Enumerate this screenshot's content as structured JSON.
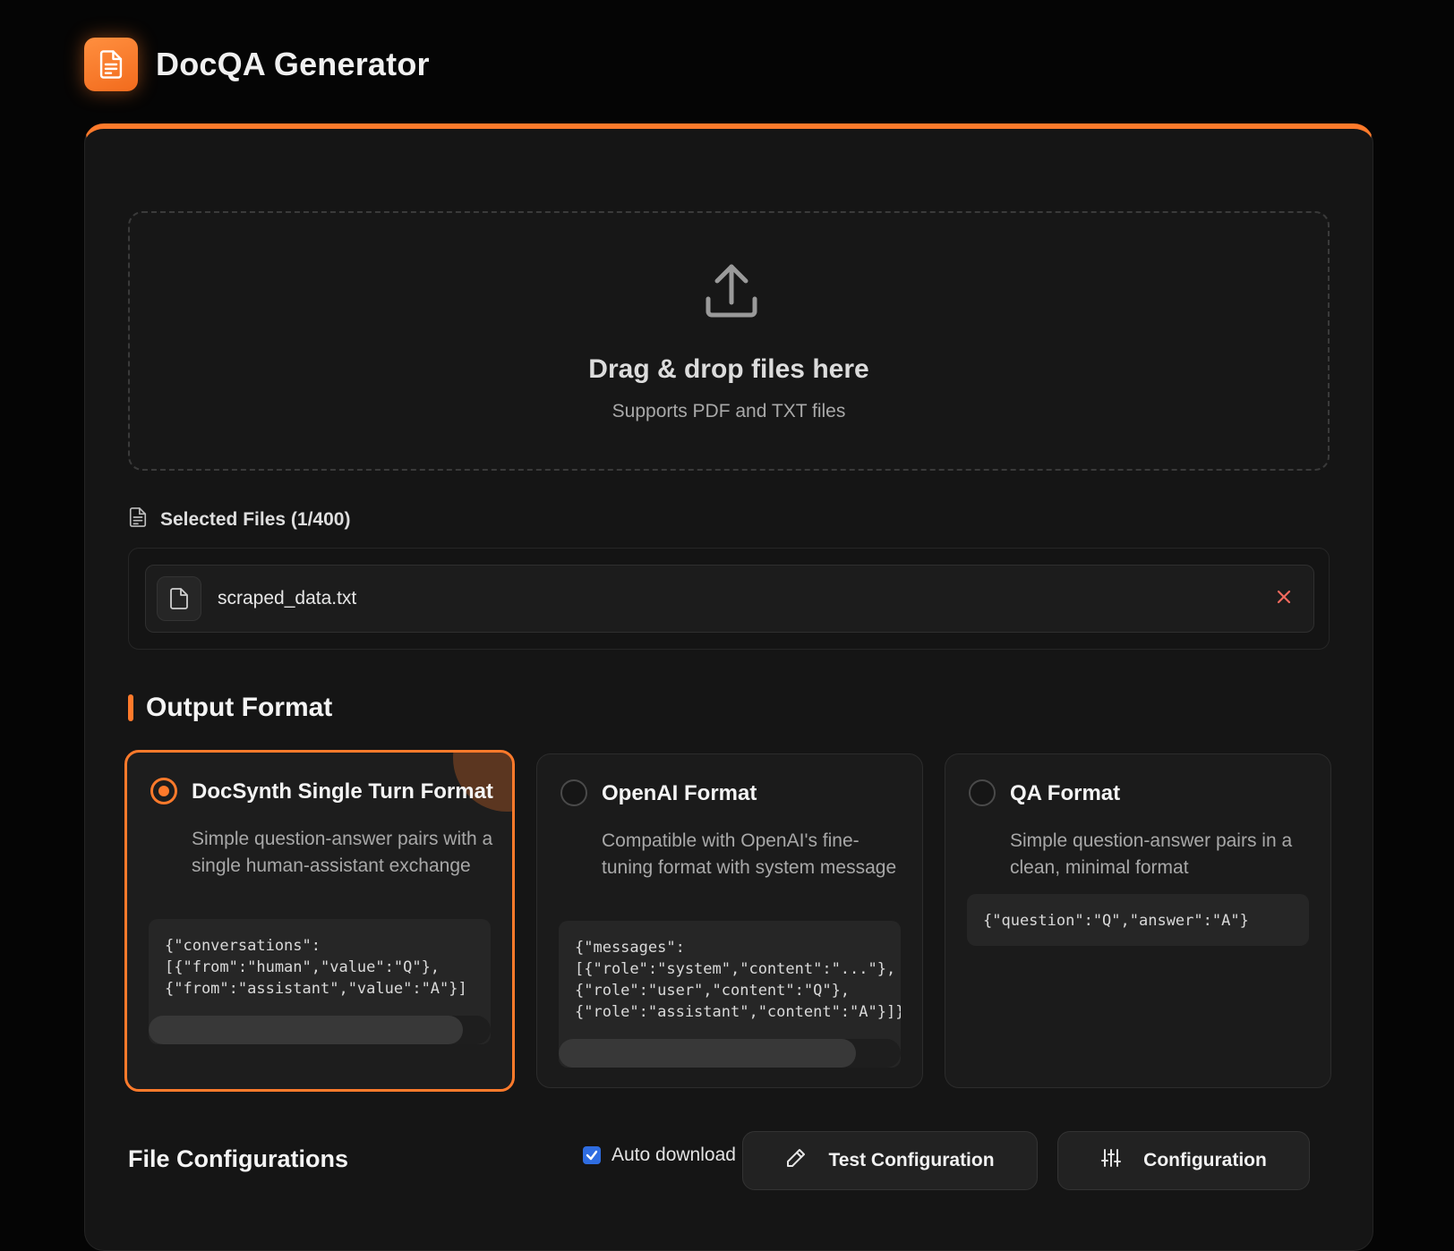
{
  "app": {
    "title": "DocQA Generator",
    "logo_icon": "document-icon"
  },
  "theme": {
    "accent": "#ff7a2b",
    "background": "#050505",
    "panel": "#151515"
  },
  "upload": {
    "title": "Drag & drop files here",
    "subtitle": "Supports PDF and TXT files",
    "icon": "upload-icon"
  },
  "files": {
    "heading": "Selected Files (1/400)",
    "items": [
      {
        "name": "scraped_data.txt"
      }
    ]
  },
  "output_format": {
    "title": "Output Format",
    "options": [
      {
        "title": "DocSynth Single Turn Format",
        "description": "Simple question-answer pairs with a single human-assistant exchange",
        "example": "{\"conversations\":\n[{\"from\":\"human\",\"value\":\"Q\"},\n{\"from\":\"assistant\",\"value\":\"A\"}]",
        "selected": true,
        "scroll_fraction": 0.92
      },
      {
        "title": "OpenAI Format",
        "description": "Compatible with OpenAI's fine-tuning format with system message",
        "example": "{\"messages\":\n[{\"role\":\"system\",\"content\":\"...\"},\n{\"role\":\"user\",\"content\":\"Q\"},\n{\"role\":\"assistant\",\"content\":\"A\"}]}",
        "selected": false,
        "scroll_fraction": 0.87
      },
      {
        "title": "QA Format",
        "description": "Simple question-answer pairs in a clean, minimal format",
        "example": "{\"question\":\"Q\",\"answer\":\"A\"}",
        "selected": false
      }
    ]
  },
  "footer": {
    "title": "File Configurations",
    "auto_download_label": "Auto download",
    "auto_download_checked": true,
    "test_button": "Test Configuration",
    "config_button": "Configuration"
  }
}
